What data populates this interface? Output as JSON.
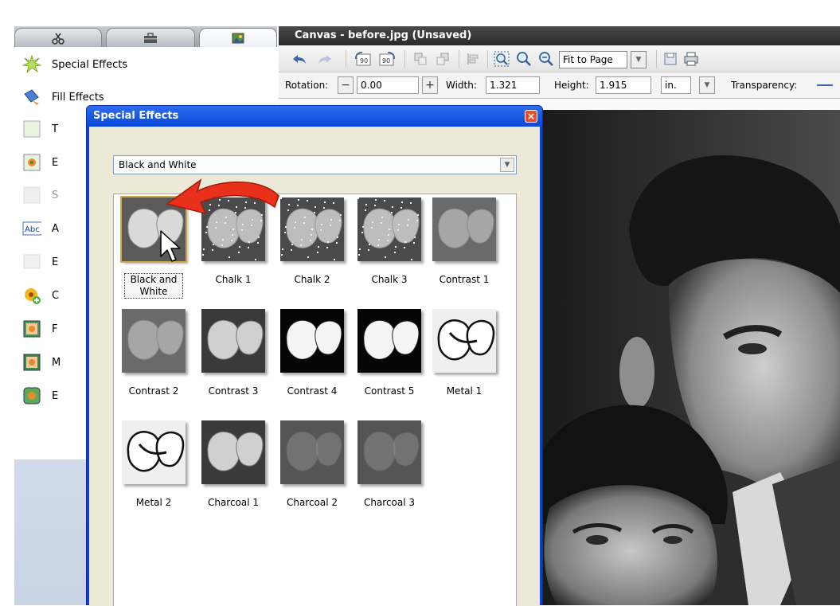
{
  "sidebar": {
    "tabs": [
      {
        "icon": "scissors-icon"
      },
      {
        "icon": "toolbox-icon"
      },
      {
        "icon": "picture-icon"
      }
    ],
    "items": [
      {
        "label": "Special Effects",
        "icon": "starburst-icon",
        "icon_color": "#b8e05a"
      },
      {
        "label": "Fill Effects",
        "icon": "paint-bucket-icon",
        "icon_color": "#4a7fd1"
      },
      {
        "label": "T",
        "icon": "blank-page-icon",
        "icon_color": "#d9eac3"
      },
      {
        "label": "E",
        "icon": "flower-frame-icon",
        "icon_color": "#f28a2b"
      },
      {
        "label": "S",
        "icon": "disabled-icon",
        "icon_color": "#d8d8d8"
      },
      {
        "label": "A",
        "icon": "abc-text-icon",
        "icon_color": "#3b6cc9"
      },
      {
        "label": "E",
        "icon": "disabled-edit-icon",
        "icon_color": "#d8d8d8"
      },
      {
        "label": "C",
        "icon": "flower-add-icon",
        "icon_color": "#f5b81c"
      },
      {
        "label": "F",
        "icon": "frame-icon",
        "icon_color": "#e78b2a"
      },
      {
        "label": "M",
        "icon": "mask-icon",
        "icon_color": "#e78b2a"
      },
      {
        "label": "E",
        "icon": "edge-icon",
        "icon_color": "#e78b2a"
      }
    ]
  },
  "canvas": {
    "title": "Canvas - before.jpg (Unsaved)",
    "zoom_option": "Fit to Page",
    "rotation_label": "Rotation:",
    "rotation_value": "0.00",
    "width_label": "Width:",
    "width_value": "1.321",
    "height_label": "Height:",
    "height_value": "1.915",
    "unit": "in.",
    "transparency_label": "Transparency:"
  },
  "dialog": {
    "title": "Special Effects",
    "dropdown_value": "Black and White",
    "effects": [
      {
        "label": "Black and White",
        "style": "bw",
        "selected": true
      },
      {
        "label": "Chalk 1",
        "style": "chalk"
      },
      {
        "label": "Chalk 2",
        "style": "chalk"
      },
      {
        "label": "Chalk 3",
        "style": "chalk"
      },
      {
        "label": "Contrast 1",
        "style": "low"
      },
      {
        "label": "Contrast 2",
        "style": "low"
      },
      {
        "label": "Contrast 3",
        "style": "mid"
      },
      {
        "label": "Contrast 4",
        "style": "high"
      },
      {
        "label": "Contrast 5",
        "style": "high"
      },
      {
        "label": "Metal 1",
        "style": "metal"
      },
      {
        "label": "Metal 2",
        "style": "metal"
      },
      {
        "label": "Charcoal 1",
        "style": "mid"
      },
      {
        "label": "Charcoal 2",
        "style": "blur"
      },
      {
        "label": "Charcoal 3",
        "style": "blur"
      }
    ]
  },
  "colors": {
    "dialog_title": "#0a48d8",
    "highlight_arrow": "#e8301a",
    "selection_outline": "#d4a64a"
  }
}
